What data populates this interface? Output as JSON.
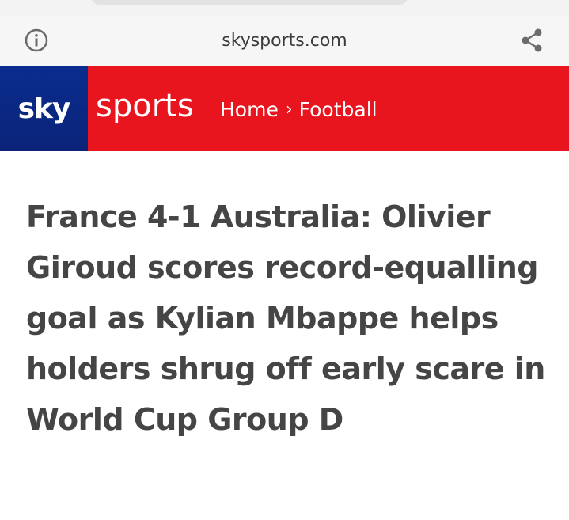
{
  "browser": {
    "url": "skysports.com",
    "info_icon": "info-icon",
    "share_icon": "share-icon"
  },
  "header": {
    "logo_sky": "sky",
    "logo_sports": "sports",
    "breadcrumb": [
      "Home",
      "Football"
    ],
    "breadcrumb_separator": "›",
    "colors": {
      "sky_blue": "#0a2c8e",
      "sports_red": "#e8141e"
    }
  },
  "article": {
    "headline": "France 4-1 Australia: Olivier Giroud scores record-equalling goal as Kylian Mbappe helps holders shrug off early scare in World Cup Group D"
  }
}
